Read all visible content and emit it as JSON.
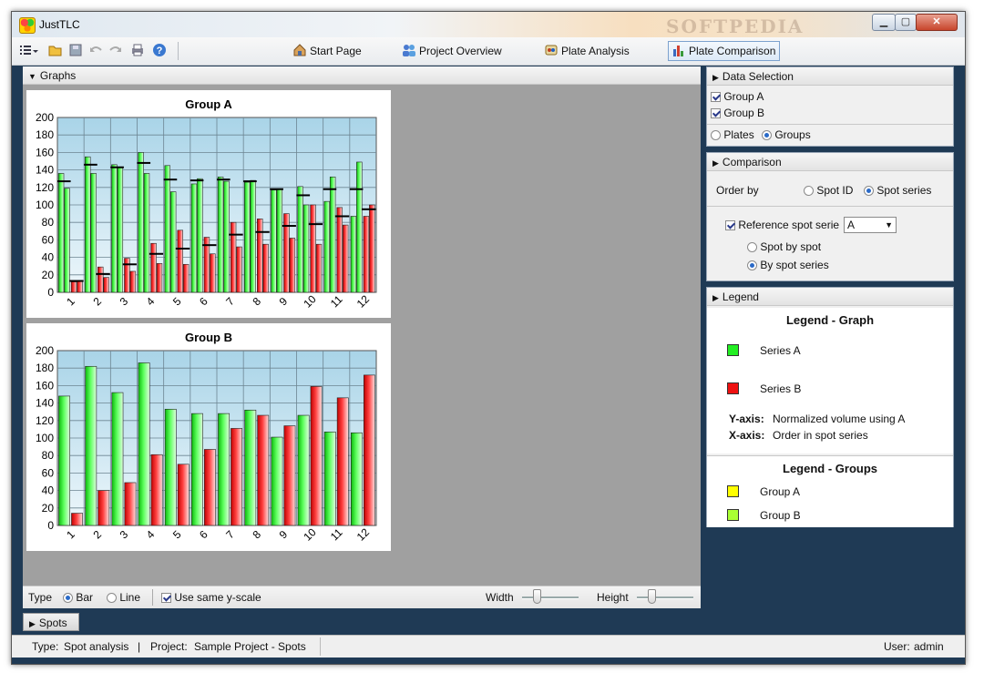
{
  "window": {
    "title": "JustTLC",
    "watermark": "SOFTPEDIA"
  },
  "toolbar": {
    "nav": [
      {
        "label": "Start Page",
        "icon": "home-icon"
      },
      {
        "label": "Project Overview",
        "icon": "users-icon"
      },
      {
        "label": "Plate Analysis",
        "icon": "plate-icon"
      },
      {
        "label": "Plate Comparison",
        "icon": "bar-chart-icon",
        "active": true
      }
    ]
  },
  "graphs_panel": {
    "label": "Graphs"
  },
  "chart_data": [
    {
      "type": "bar",
      "title": "Group A",
      "categories": [
        "1",
        "2",
        "3",
        "4",
        "5",
        "6",
        "7",
        "8",
        "9",
        "10",
        "11",
        "12"
      ],
      "ylim": [
        0,
        200
      ],
      "yticks": [
        0,
        20,
        40,
        60,
        80,
        100,
        120,
        140,
        160,
        180,
        200
      ],
      "series": [
        {
          "name": "Series A",
          "color": "#22dd22",
          "values": [
            [
              136,
              119
            ],
            [
              155,
              136
            ],
            [
              146,
              143
            ],
            [
              160,
              136
            ],
            [
              145,
              115
            ],
            [
              124,
              130
            ],
            [
              132,
              127
            ],
            [
              126,
              128
            ],
            [
              117,
              118
            ],
            [
              121,
              100
            ],
            [
              104,
              132
            ],
            [
              87,
              149
            ]
          ]
        },
        {
          "name": "Series B",
          "color": "#ee2222",
          "values": [
            [
              12,
              13
            ],
            [
              29,
              17
            ],
            [
              39,
              24
            ],
            [
              56,
              33
            ],
            [
              71,
              32
            ],
            [
              63,
              44
            ],
            [
              80,
              52
            ],
            [
              84,
              55
            ],
            [
              90,
              62
            ],
            [
              100,
              55
            ],
            [
              97,
              77
            ],
            [
              87,
              100
            ]
          ]
        }
      ],
      "markers": {
        "a": [
          127,
          146,
          143,
          148,
          129,
          128,
          129,
          127,
          118,
          111,
          118,
          118
        ],
        "b": [
          13,
          21,
          32,
          44,
          50,
          54,
          66,
          69,
          76,
          78,
          87,
          95
        ]
      }
    },
    {
      "type": "bar",
      "title": "Group B",
      "categories": [
        "1",
        "2",
        "3",
        "4",
        "5",
        "6",
        "7",
        "8",
        "9",
        "10",
        "11",
        "12"
      ],
      "ylim": [
        0,
        200
      ],
      "yticks": [
        0,
        20,
        40,
        60,
        80,
        100,
        120,
        140,
        160,
        180,
        200
      ],
      "series": [
        {
          "name": "Series A",
          "color": "#22dd22",
          "values": [
            148,
            182,
            152,
            186,
            133,
            128,
            128,
            132,
            101,
            126,
            107,
            106
          ]
        },
        {
          "name": "Series B",
          "color": "#ee2222",
          "values": [
            14,
            40,
            49,
            81,
            70,
            87,
            111,
            126,
            114,
            159,
            146,
            172
          ]
        }
      ]
    }
  ],
  "bottom": {
    "type_label": "Type",
    "bar_label": "Bar",
    "line_label": "Line",
    "type_selected": "Bar",
    "same_y_label": "Use same y-scale",
    "same_y_checked": true,
    "width_label": "Width",
    "height_label": "Height",
    "width_value": 0.15,
    "height_value": 0.2
  },
  "spots_tab": {
    "label": "Spots"
  },
  "data_selection": {
    "header": "Data Selection",
    "groups": [
      {
        "label": "Group A",
        "checked": true
      },
      {
        "label": "Group B",
        "checked": true
      }
    ],
    "plates_label": "Plates",
    "groups_label": "Groups",
    "selected": "Groups"
  },
  "comparison": {
    "header": "Comparison",
    "order_by_label": "Order by",
    "spot_id_label": "Spot ID",
    "spot_series_label": "Spot series",
    "order_selected": "Spot series",
    "reference_label": "Reference spot serie",
    "reference_checked": true,
    "reference_value": "A",
    "spot_by_spot_label": "Spot by spot",
    "by_spot_series_label": "By spot series",
    "mode_selected": "By spot series"
  },
  "legend": {
    "header": "Legend",
    "graph_title": "Legend - Graph",
    "series": [
      {
        "label": "Series A",
        "color": "#22ee22"
      },
      {
        "label": "Series B",
        "color": "#ee1111"
      }
    ],
    "y_axis_key": "Y-axis:",
    "y_axis_value": "Normalized volume using A",
    "x_axis_key": "X-axis:",
    "x_axis_value": "Order in spot series",
    "groups_title": "Legend - Groups",
    "groups": [
      {
        "label": "Group A",
        "color": "#ffff00"
      },
      {
        "label": "Group B",
        "color": "#aaff33"
      }
    ]
  },
  "status": {
    "type_key": "Type:",
    "type_value": "Spot analysis",
    "project_key": "Project:",
    "project_value": "Sample Project - Spots",
    "user_key": "User:",
    "user_value": "admin"
  }
}
